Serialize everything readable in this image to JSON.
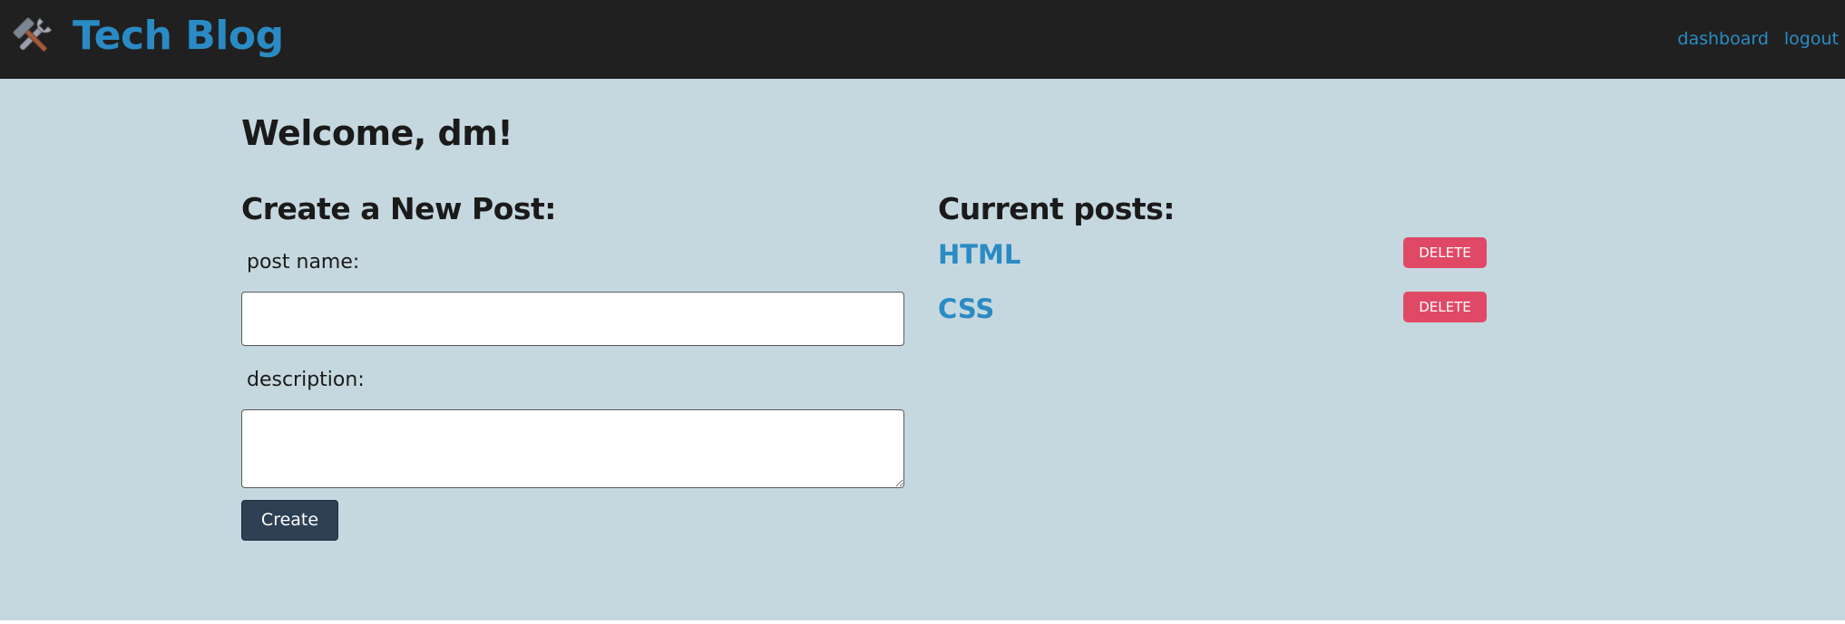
{
  "header": {
    "brand_icon": "hammer-and-wrench-icon",
    "brand_title": "Tech Blog",
    "nav": {
      "dashboard": "dashboard",
      "logout": "logout"
    }
  },
  "main": {
    "welcome": "Welcome, dm!",
    "create_form": {
      "heading": "Create a New Post:",
      "post_name_label": "post name:",
      "post_name_value": "",
      "description_label": "description:",
      "description_value": "",
      "create_button": "Create"
    },
    "posts": {
      "heading": "Current posts:",
      "items": [
        {
          "title": "HTML",
          "delete_label": "DELETE"
        },
        {
          "title": "CSS",
          "delete_label": "DELETE"
        }
      ]
    }
  },
  "colors": {
    "navbar_bg": "#202020",
    "brand_blue": "#2a8bc4",
    "page_bg": "#c6d8df",
    "create_button_bg": "#2e4053",
    "delete_button_bg": "#e04966"
  }
}
